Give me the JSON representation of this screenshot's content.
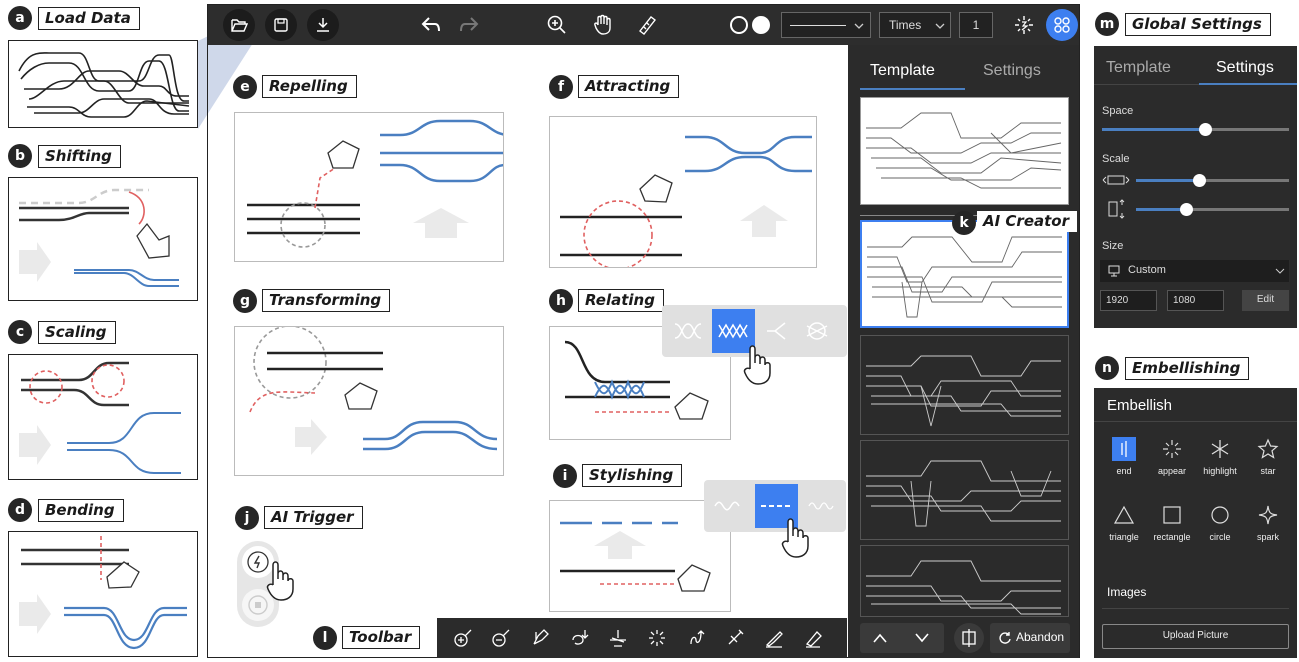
{
  "labels": {
    "a": "a",
    "b": "b",
    "c": "c",
    "d": "d",
    "e": "e",
    "f": "f",
    "g": "g",
    "h": "h",
    "i": "i",
    "j": "j",
    "k": "k",
    "l": "l",
    "m": "m",
    "n": "n"
  },
  "sections": {
    "load_data": "Load Data",
    "shifting": "Shifting",
    "scaling": "Scaling",
    "bending": "Bending",
    "repelling": "Repelling",
    "attracting": "Attracting",
    "transforming": "Transforming",
    "relating": "Relating",
    "stylishing": "Stylishing",
    "ai_trigger": "AI Trigger",
    "ai_creator": "AI Creator",
    "toolbar": "Toolbar",
    "global_settings": "Global Settings",
    "embellishing": "Embellishing"
  },
  "top_toolbar": {
    "font": "Times",
    "line_width": "1"
  },
  "right_panel": {
    "tabs": [
      "Template",
      "Settings"
    ],
    "abandon_label": "Abandon"
  },
  "settings_panel": {
    "tabs": [
      "Template",
      "Settings"
    ],
    "space_label": "Space",
    "space_value": 0.55,
    "scale_label": "Scale",
    "scale_h_value": 0.41,
    "scale_v_value": 0.33,
    "size_label": "Size",
    "size_option": "Custom",
    "width": "1920",
    "height": "1080",
    "edit_label": "Edit"
  },
  "embellish_panel": {
    "title": "Embellish",
    "items": [
      "end",
      "appear",
      "highlight",
      "star",
      "triangle",
      "rectangle",
      "circle",
      "spark"
    ],
    "images_label": "Images",
    "upload_label": "Upload Picture"
  },
  "colors": {
    "accent": "#4a7fc1",
    "dark_panel": "#2b2b2b",
    "highlight_blue": "#3d7ff0",
    "dashed_red": "#e07070"
  }
}
